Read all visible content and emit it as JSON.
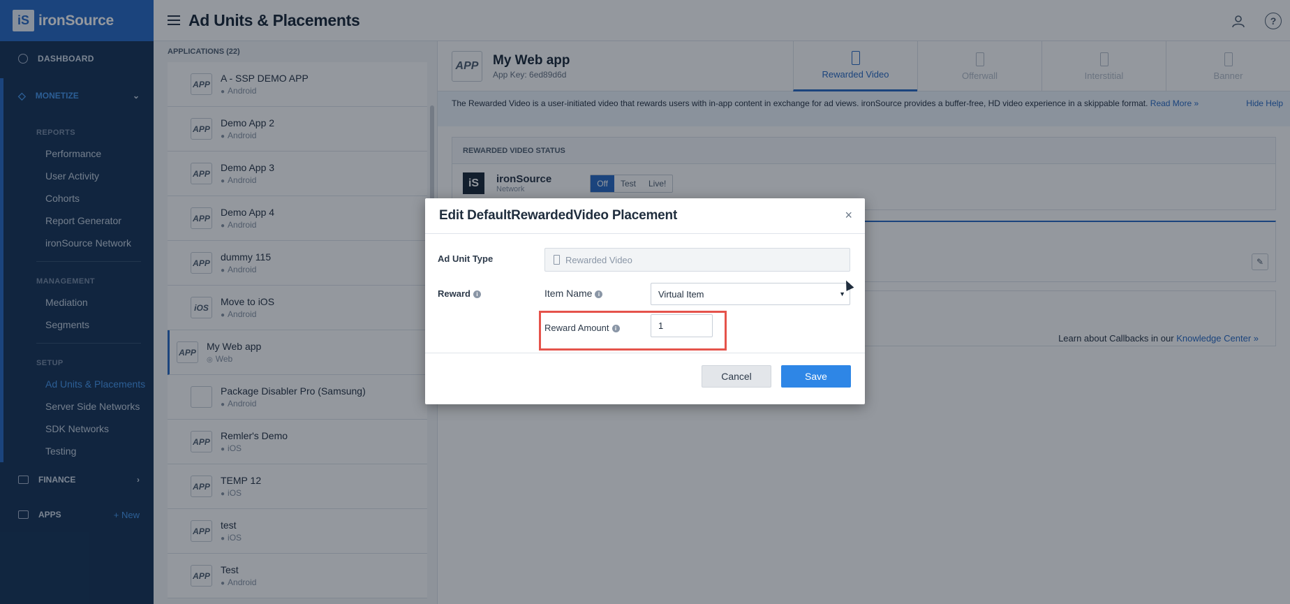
{
  "brand": {
    "logo_mark": "iS",
    "name": "ironSource"
  },
  "header": {
    "title": "Ad Units & Placements",
    "icons": [
      "user-icon",
      "help-icon"
    ]
  },
  "sidebar": {
    "dashboard": "DASHBOARD",
    "monetize": "MONETIZE",
    "reports_label": "REPORTS",
    "reports": [
      "Performance",
      "User Activity",
      "Cohorts",
      "Report Generator",
      "ironSource Network"
    ],
    "management_label": "MANAGEMENT",
    "management": [
      "Mediation",
      "Segments"
    ],
    "setup_label": "SETUP",
    "setup": [
      "Ad Units & Placements",
      "Server Side Networks",
      "SDK Networks",
      "Testing"
    ],
    "finance": "FINANCE",
    "apps": "APPS",
    "apps_new": "+ New"
  },
  "applist": {
    "title": "APPLICATIONS (22)",
    "apps": [
      {
        "name": "A - SSP DEMO APP",
        "platform": "Android",
        "thumb": "APP"
      },
      {
        "name": "Demo App 2",
        "platform": "Android",
        "thumb": "APP"
      },
      {
        "name": "Demo App 3",
        "platform": "Android",
        "thumb": "APP"
      },
      {
        "name": "Demo App 4",
        "platform": "Android",
        "thumb": "APP"
      },
      {
        "name": "dummy 115",
        "platform": "Android",
        "thumb": "APP"
      },
      {
        "name": "Move to iOS",
        "platform": "Android",
        "thumb": "iOS"
      },
      {
        "name": "My Web app",
        "platform": "Web",
        "thumb": "APP"
      },
      {
        "name": "Package Disabler Pro (Samsung)",
        "platform": "Android",
        "thumb": ""
      },
      {
        "name": "Remler's Demo",
        "platform": "iOS",
        "thumb": "APP"
      },
      {
        "name": "TEMP 12",
        "platform": "iOS",
        "thumb": "APP"
      },
      {
        "name": "test",
        "platform": "iOS",
        "thumb": "APP"
      },
      {
        "name": "Test",
        "platform": "Android",
        "thumb": "APP"
      }
    ]
  },
  "main": {
    "app_title": "My Web app",
    "app_key": "App Key: 6ed89d6d",
    "thumb": "APP",
    "tabs": [
      "Rewarded Video",
      "Offerwall",
      "Interstitial",
      "Banner"
    ],
    "help_text": "The Rewarded Video is a user-initiated video that rewards users with in-app content in exchange for ad views. ironSource provides a buffer-free, HD video experience in a skippable format.",
    "read_more": "Read More »",
    "hide_help": "Hide Help",
    "status_title": "REWARDED VIDEO STATUS",
    "network_name": "ironSource",
    "network_sub": "Network",
    "status_options": [
      "Off",
      "Test",
      "Live!"
    ],
    "callbacks_text": "Learn about Callbacks in our",
    "callbacks_link": "Knowledge Center »"
  },
  "modal": {
    "title": "Edit DefaultRewardedVideo Placement",
    "ad_unit_type_label": "Ad Unit Type",
    "ad_unit_type_value": "Rewarded Video",
    "reward_label": "Reward",
    "item_name_label": "Item Name",
    "item_name_value": "Virtual Item",
    "reward_amount_label": "Reward Amount",
    "reward_amount_value": "1",
    "cancel": "Cancel",
    "save": "Save",
    "close": "×"
  },
  "colors": {
    "accent": "#2f6fc6",
    "sidebar": "#1e3a5c",
    "highlight": "#e5534b",
    "save": "#2e86e6"
  }
}
